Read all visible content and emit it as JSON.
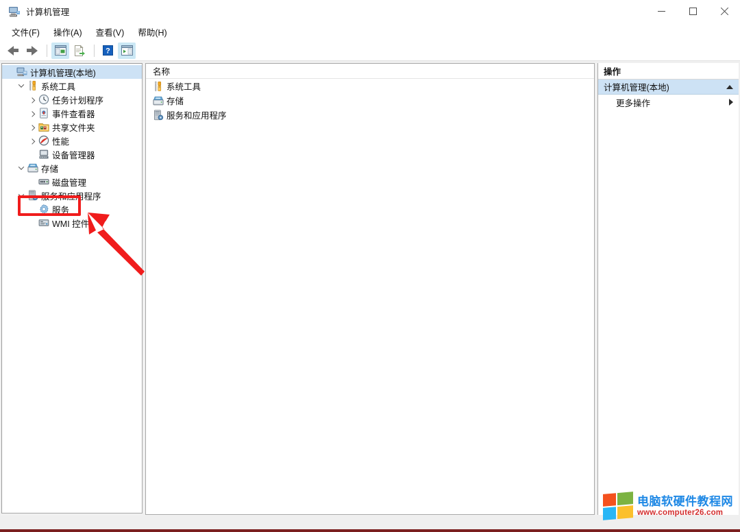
{
  "window": {
    "title": "计算机管理",
    "icon": "computer-management-icon",
    "controls": {
      "minimize": "最小化",
      "maximize": "最大化",
      "close": "关闭"
    }
  },
  "menubar": {
    "items": [
      {
        "label": "文件(F)",
        "name": "menu-file"
      },
      {
        "label": "操作(A)",
        "name": "menu-action"
      },
      {
        "label": "查看(V)",
        "name": "menu-view"
      },
      {
        "label": "帮助(H)",
        "name": "menu-help"
      }
    ]
  },
  "toolbar": {
    "buttons": [
      {
        "name": "back-button",
        "icon": "arrow-left-icon",
        "highlighted": false
      },
      {
        "name": "forward-button",
        "icon": "arrow-right-icon",
        "highlighted": false
      },
      {
        "name": "show-hide-console-tree-button",
        "icon": "console-tree-icon",
        "highlighted": true
      },
      {
        "name": "export-list-button",
        "icon": "export-list-icon",
        "highlighted": false
      },
      {
        "name": "help-button",
        "icon": "question-mark-icon",
        "highlighted": false
      },
      {
        "name": "show-action-pane-button",
        "icon": "action-pane-icon",
        "highlighted": true
      }
    ]
  },
  "tree": {
    "items": [
      {
        "label": "计算机管理(本地)",
        "indent": 0,
        "expander": "none",
        "icon": "computer-management-icon",
        "selected": true
      },
      {
        "label": "系统工具",
        "indent": 1,
        "expander": "down",
        "icon": "system-tools-icon",
        "selected": false
      },
      {
        "label": "任务计划程序",
        "indent": 2,
        "expander": "right",
        "icon": "task-scheduler-icon",
        "selected": false
      },
      {
        "label": "事件查看器",
        "indent": 2,
        "expander": "right",
        "icon": "event-viewer-icon",
        "selected": false
      },
      {
        "label": "共享文件夹",
        "indent": 2,
        "expander": "right",
        "icon": "shared-folders-icon",
        "selected": false
      },
      {
        "label": "性能",
        "indent": 2,
        "expander": "right",
        "icon": "performance-icon",
        "selected": false
      },
      {
        "label": "设备管理器",
        "indent": 2,
        "expander": "none",
        "icon": "device-manager-icon",
        "selected": false
      },
      {
        "label": "存储",
        "indent": 1,
        "expander": "down",
        "icon": "storage-icon",
        "selected": false
      },
      {
        "label": "磁盘管理",
        "indent": 2,
        "expander": "none",
        "icon": "disk-management-icon",
        "selected": false
      },
      {
        "label": "服务和应用程序",
        "indent": 1,
        "expander": "down",
        "icon": "services-and-applications-icon",
        "selected": false
      },
      {
        "label": "服务",
        "indent": 2,
        "expander": "none",
        "icon": "services-gear-icon",
        "selected": false
      },
      {
        "label": "WMI 控件",
        "indent": 2,
        "expander": "none",
        "icon": "wmi-control-icon",
        "selected": false
      }
    ]
  },
  "list": {
    "column_header": "名称",
    "rows": [
      {
        "label": "系统工具",
        "icon": "system-tools-icon"
      },
      {
        "label": "存储",
        "icon": "storage-icon"
      },
      {
        "label": "服务和应用程序",
        "icon": "services-and-applications-icon"
      }
    ]
  },
  "actions": {
    "title": "操作",
    "group_label": "计算机管理(本地)",
    "group_collapse_icon": "triangle-up-icon",
    "items": [
      {
        "label": "更多操作",
        "submenu_icon": "triangle-right-icon"
      }
    ]
  },
  "annotations": {
    "highlight_box": {
      "target": "服务",
      "color": "#f01c1c"
    },
    "arrow": {
      "points_to": "服务",
      "color": "#f01c1c"
    }
  },
  "watermark": {
    "site_name": "电脑软硬件教程网",
    "url": "www.computer26.com",
    "logo": "windows-logo-icon",
    "colors": {
      "name_color": "#1e88e5",
      "url_color": "#d32f2f",
      "q1": "#f4511e",
      "q2": "#7cb342",
      "q3": "#29b6f6",
      "q4": "#fbc02d"
    }
  }
}
